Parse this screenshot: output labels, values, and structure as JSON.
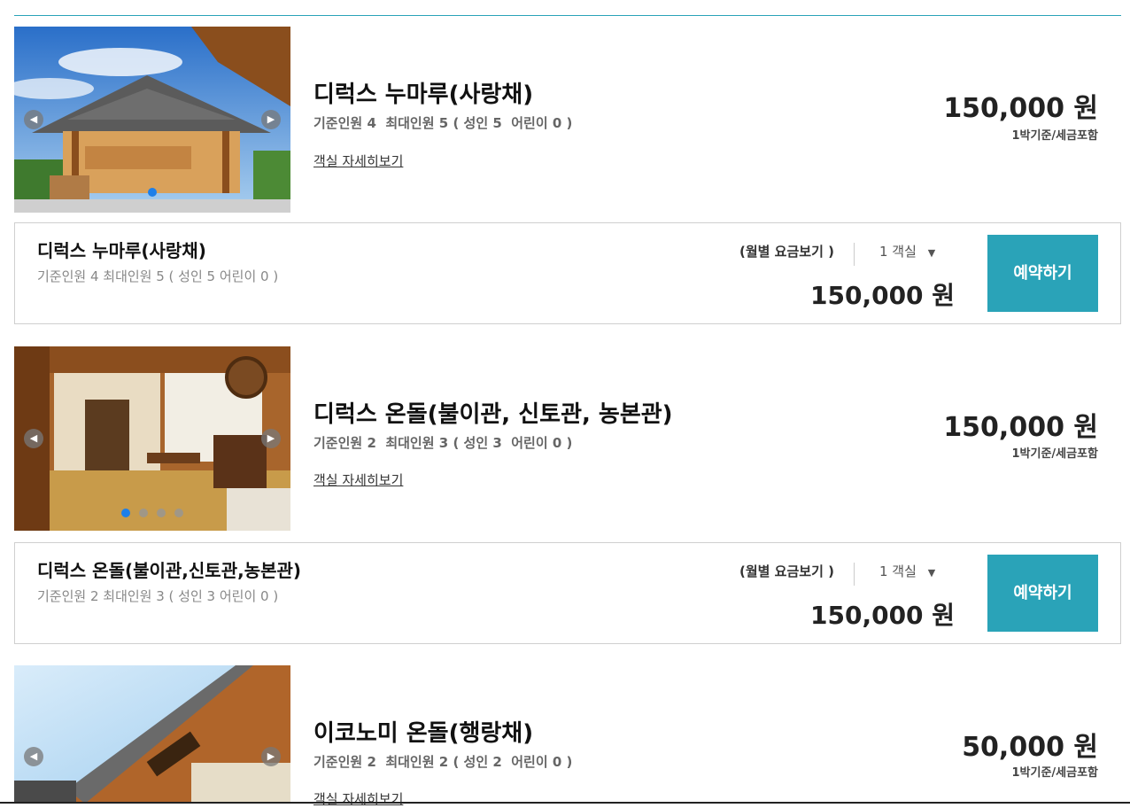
{
  "rooms": [
    {
      "name": "디럭스 누마루(사랑채)",
      "cap_std_label": "기준인원",
      "cap_std": "4",
      "cap_max_label": "최대인원",
      "cap_max": "5",
      "adult_label": "( 성인",
      "adult": "5",
      "child_label": "어린이",
      "child": "0 )",
      "detail_link": "객실 자세히보기",
      "price": "150,000 원",
      "price_note": "1박기준/세금포함",
      "book_name": "디럭스 누마루(사랑채)",
      "book_cap": "기준인원  4   최대인원  5 ( 성인  5   어린이  0 )",
      "rate_link": "(월별 요금보기 )",
      "room_count": "1 객실",
      "book_price": "150,000 원",
      "book_button": "예약하기",
      "slide_count": 1,
      "active_slide": 0
    },
    {
      "name": "디럭스 온돌(불이관, 신토관, 농본관)",
      "cap_std_label": "기준인원",
      "cap_std": "2",
      "cap_max_label": "최대인원",
      "cap_max": "3",
      "adult_label": "( 성인",
      "adult": "3",
      "child_label": "어린이",
      "child": "0 )",
      "detail_link": "객실 자세히보기",
      "price": "150,000 원",
      "price_note": "1박기준/세금포함",
      "book_name": "디럭스 온돌(불이관,신토관,농본관)",
      "book_cap": "기준인원  2   최대인원  3 ( 성인  3   어린이  0 )",
      "rate_link": "(월별 요금보기 )",
      "room_count": "1 객실",
      "book_price": "150,000 원",
      "book_button": "예약하기",
      "slide_count": 4,
      "active_slide": 0
    },
    {
      "name": "이코노미 온돌(행랑채)",
      "cap_std_label": "기준인원",
      "cap_std": "2",
      "cap_max_label": "최대인원",
      "cap_max": "2",
      "adult_label": "( 성인",
      "adult": "2",
      "child_label": "어린이",
      "child": "0 )",
      "detail_link": "객실 자세히보기",
      "price": "50,000 원",
      "price_note": "1박기준/세금포함"
    }
  ],
  "icons": {
    "prev": "chevron-left-icon",
    "next": "chevron-right-icon",
    "dropdown": "caret-down-icon"
  },
  "colors": {
    "accent": "#2aa3b8",
    "active_dot": "#1e7fe8"
  }
}
